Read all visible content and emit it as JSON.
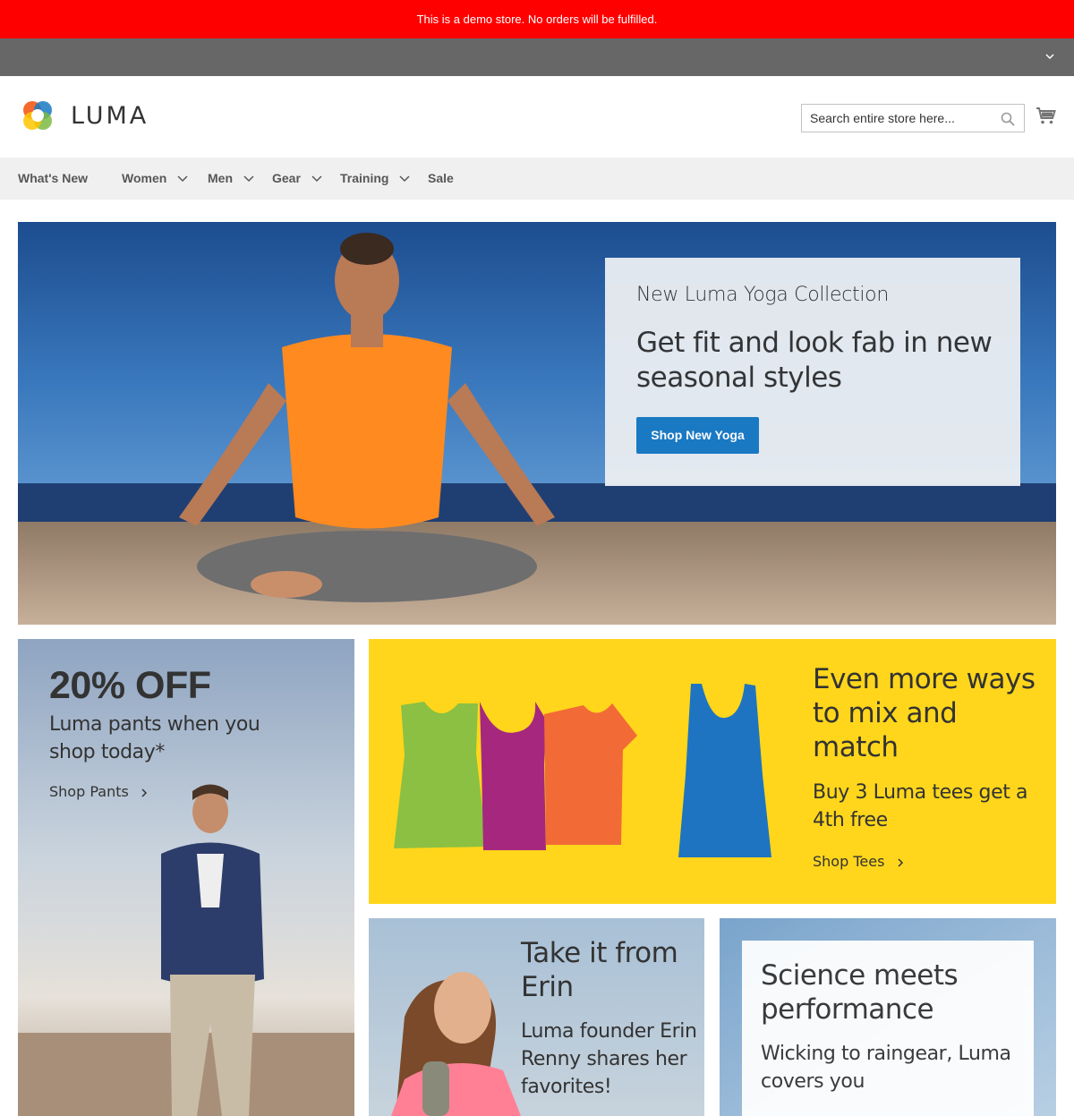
{
  "demo_notice": "This is a demo store. No orders will be fulfilled.",
  "header": {
    "logo_text": "LUMA",
    "search": {
      "placeholder": "Search entire store here...",
      "value": ""
    },
    "icons": {
      "search": "search-icon",
      "cart": "cart-icon",
      "panel_toggle": "chevron-down-icon"
    }
  },
  "nav": {
    "items": [
      {
        "label": "What's New",
        "has_submenu": false
      },
      {
        "label": "Women",
        "has_submenu": true
      },
      {
        "label": "Men",
        "has_submenu": true
      },
      {
        "label": "Gear",
        "has_submenu": true
      },
      {
        "label": "Training",
        "has_submenu": true
      },
      {
        "label": "Sale",
        "has_submenu": false
      }
    ]
  },
  "hero": {
    "subtitle": "New Luma Yoga Collection",
    "title": "Get fit and look fab in new seasonal styles",
    "button": "Shop New Yoga"
  },
  "promos": {
    "pants": {
      "headline": "20% OFF",
      "text": "Luma pants when you shop today*",
      "link": "Shop Pants"
    },
    "tees": {
      "title": "Even more ways to mix and match",
      "text": "Buy 3 Luma tees get a 4th free",
      "link": "Shop Tees"
    },
    "erin": {
      "title": "Take it from Erin",
      "text": "Luma founder Erin Renny shares her favorites!"
    },
    "science": {
      "title": "Science meets performance",
      "text": "Wicking to raingear, Luma covers you"
    }
  },
  "colors": {
    "demo_notice": "#ff0000",
    "panel": "#676767",
    "nav_bg": "#f0f0f0",
    "primary_button": "#1979c3",
    "tees_bg": "#ffd61b"
  }
}
